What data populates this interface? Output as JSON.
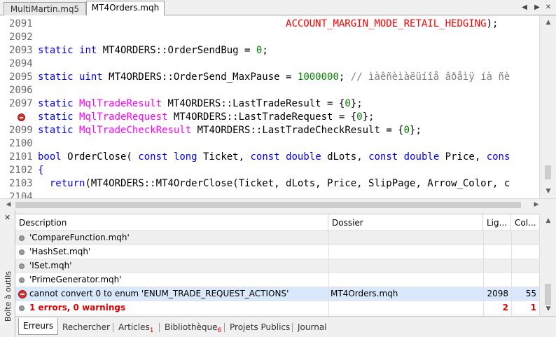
{
  "tabs": {
    "items": [
      {
        "label": "MultiMartin.mq5"
      },
      {
        "label": "MT4Orders.mqh"
      }
    ],
    "active": 1,
    "nav_icons": [
      "chevron-left-icon",
      "chevron-right-icon",
      "close-icon"
    ]
  },
  "editor": {
    "colors": {
      "keyword": "#0000ff",
      "type": "#ff00ff",
      "number": "#008000",
      "comment": "#808080",
      "constant": "#ff0000"
    },
    "lines": [
      {
        "num": "2091",
        "parts": [
          {
            "t": "                                          ",
            "c": ""
          },
          {
            "t": "ACCOUNT_MARGIN_MODE_RETAIL_HEDGING",
            "c": "str"
          },
          {
            "t": ");",
            "c": ""
          }
        ]
      },
      {
        "num": "2092",
        "parts": []
      },
      {
        "num": "2093",
        "parts": [
          {
            "t": "static",
            "c": "kw"
          },
          {
            "t": " ",
            "c": ""
          },
          {
            "t": "int",
            "c": "kw"
          },
          {
            "t": " MT4ORDERS::OrderSendBug = ",
            "c": ""
          },
          {
            "t": "0",
            "c": "num"
          },
          {
            "t": ";",
            "c": ""
          }
        ]
      },
      {
        "num": "2094",
        "parts": []
      },
      {
        "num": "2095",
        "parts": [
          {
            "t": "static",
            "c": "kw"
          },
          {
            "t": " ",
            "c": ""
          },
          {
            "t": "uint",
            "c": "kw"
          },
          {
            "t": " MT4ORDERS::OrderSend_MaxPause = ",
            "c": ""
          },
          {
            "t": "1000000",
            "c": "num"
          },
          {
            "t": "; ",
            "c": ""
          },
          {
            "t": "// ìàêñèìàëüíîå âðåìÿ íà ñè",
            "c": "cm"
          }
        ]
      },
      {
        "num": "2096",
        "parts": []
      },
      {
        "num": "2097",
        "parts": [
          {
            "t": "static",
            "c": "kw"
          },
          {
            "t": " ",
            "c": ""
          },
          {
            "t": "MqlTradeResult",
            "c": "ty"
          },
          {
            "t": " MT4ORDERS::LastTradeResult = {",
            "c": ""
          },
          {
            "t": "0",
            "c": "num"
          },
          {
            "t": "};",
            "c": ""
          }
        ]
      },
      {
        "num": "",
        "breakpoint": true,
        "parts": [
          {
            "t": "static",
            "c": "kw"
          },
          {
            "t": " ",
            "c": ""
          },
          {
            "t": "MqlTradeRequest",
            "c": "ty"
          },
          {
            "t": " MT4ORDERS::LastTradeRequest = {",
            "c": ""
          },
          {
            "t": "0",
            "c": "num"
          },
          {
            "t": "};",
            "c": ""
          }
        ]
      },
      {
        "num": "2099",
        "parts": [
          {
            "t": "static",
            "c": "kw"
          },
          {
            "t": " ",
            "c": ""
          },
          {
            "t": "MqlTradeCheckResult",
            "c": "ty"
          },
          {
            "t": " MT4ORDERS::LastTradeCheckResult = {",
            "c": ""
          },
          {
            "t": "0",
            "c": "num"
          },
          {
            "t": "};",
            "c": ""
          }
        ]
      },
      {
        "num": "2100",
        "parts": []
      },
      {
        "num": "2101",
        "parts": [
          {
            "t": "bool",
            "c": "kw"
          },
          {
            "t": " OrderClose( ",
            "c": ""
          },
          {
            "t": "const",
            "c": "kw"
          },
          {
            "t": " ",
            "c": ""
          },
          {
            "t": "long",
            "c": "kw"
          },
          {
            "t": " Ticket, ",
            "c": ""
          },
          {
            "t": "const",
            "c": "kw"
          },
          {
            "t": " ",
            "c": ""
          },
          {
            "t": "double",
            "c": "kw"
          },
          {
            "t": " dLots, ",
            "c": ""
          },
          {
            "t": "const",
            "c": "kw"
          },
          {
            "t": " ",
            "c": ""
          },
          {
            "t": "double",
            "c": "kw"
          },
          {
            "t": " Price, ",
            "c": ""
          },
          {
            "t": "cons",
            "c": "kw"
          }
        ]
      },
      {
        "num": "2102",
        "parts": [
          {
            "t": "{",
            "c": "kw"
          }
        ]
      },
      {
        "num": "2103",
        "parts": [
          {
            "t": "  ",
            "c": ""
          },
          {
            "t": "return",
            "c": "kw"
          },
          {
            "t": "(MT4ORDERS::MT4OrderClose(Ticket, dLots, Price, SlipPage, Arrow_Color, c",
            "c": ""
          }
        ]
      },
      {
        "num": "2104",
        "parts": []
      }
    ]
  },
  "toolbox": {
    "title": "Boîte à outils",
    "close_icon": "close-icon",
    "columns": [
      "Description",
      "Dossier",
      "Lig...",
      "Col..."
    ],
    "rows": [
      {
        "icon": "info-dot-icon",
        "description": "'CompareFunction.mqh'",
        "folder": "",
        "line": "",
        "col": "",
        "style": "alt"
      },
      {
        "icon": "info-dot-icon",
        "description": "'HashSet.mqh'",
        "folder": "",
        "line": "",
        "col": "",
        "style": ""
      },
      {
        "icon": "info-dot-icon",
        "description": "'ISet.mqh'",
        "folder": "",
        "line": "",
        "col": "",
        "style": "alt"
      },
      {
        "icon": "info-dot-icon",
        "description": "'PrimeGenerator.mqh'",
        "folder": "",
        "line": "",
        "col": "",
        "style": ""
      },
      {
        "icon": "error-icon",
        "description": "cannot convert 0 to enum 'ENUM_TRADE_REQUEST_ACTIONS'",
        "folder": "MT4Orders.mqh",
        "line": "2098",
        "col": "55",
        "style": "err-row"
      },
      {
        "icon": "info-dot-icon",
        "description": "1 errors, 0 warnings",
        "folder": "",
        "line": "2",
        "col": "1",
        "style": "summary"
      }
    ],
    "bottom_tabs": [
      {
        "label": "Erreurs",
        "badge": ""
      },
      {
        "label": "Rechercher",
        "badge": ""
      },
      {
        "label": "Articles",
        "badge": "1"
      },
      {
        "label": "Bibliothèque",
        "badge": "6"
      },
      {
        "label": "Projets Publics",
        "badge": ""
      },
      {
        "label": "Journal",
        "badge": ""
      }
    ]
  }
}
